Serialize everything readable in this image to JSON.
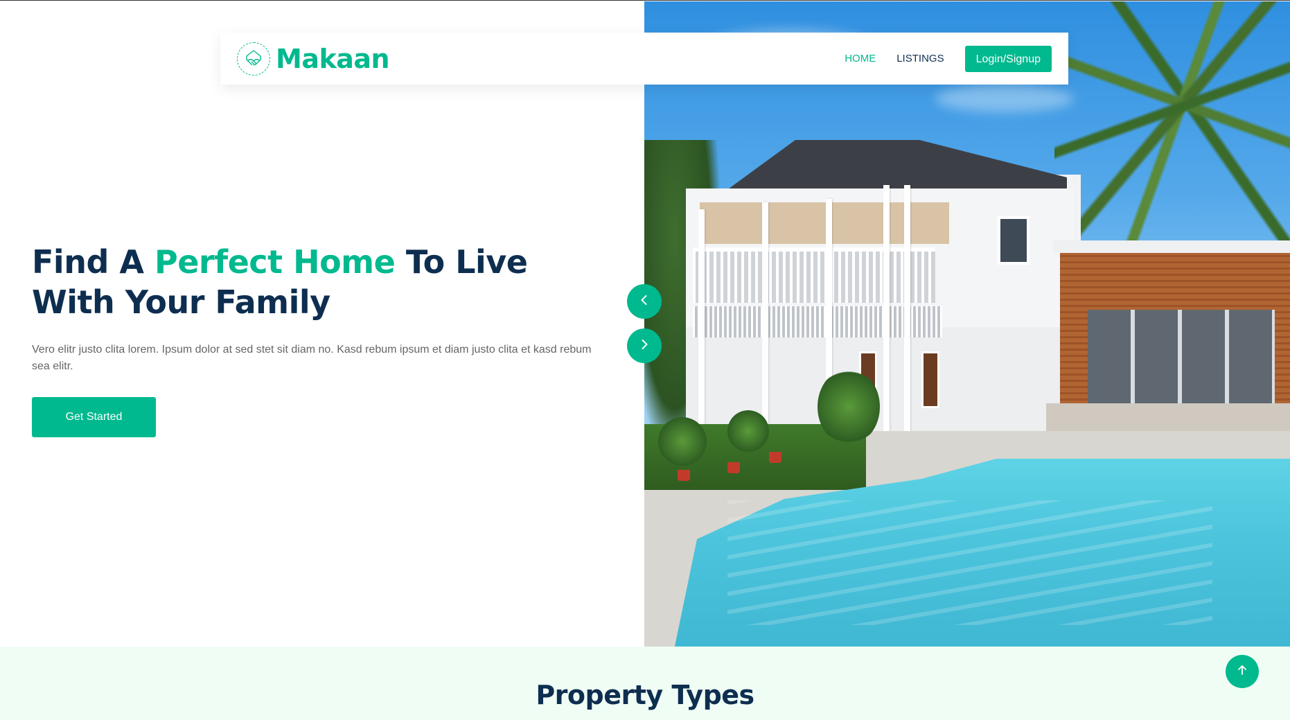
{
  "brand": {
    "name": "Makaan",
    "icon": "house-handshake-icon"
  },
  "nav": {
    "items": [
      {
        "label": "HOME",
        "active": true
      },
      {
        "label": "LISTINGS",
        "active": false
      }
    ],
    "cta_label": "Login/Signup"
  },
  "hero": {
    "title_part1": "Find A ",
    "title_accent": "Perfect Home",
    "title_part2": " To Live With Your Family",
    "description": "Vero elitr justo clita lorem. Ipsum dolor at sed stet sit diam no. Kasd rebum ipsum et diam justo clita et kasd rebum sea elitr.",
    "cta_label": "Get Started",
    "carousel": {
      "prev_icon": "chevron-left-icon",
      "next_icon": "chevron-right-icon"
    },
    "image_subject": "house-with-pool-photo"
  },
  "property_types": {
    "title": "Property Types"
  },
  "back_to_top": {
    "icon": "arrow-up-icon"
  },
  "colors": {
    "primary": "#00b98e",
    "dark": "#0e2e50",
    "section_bg": "#effdf5",
    "text_muted": "#666565"
  }
}
